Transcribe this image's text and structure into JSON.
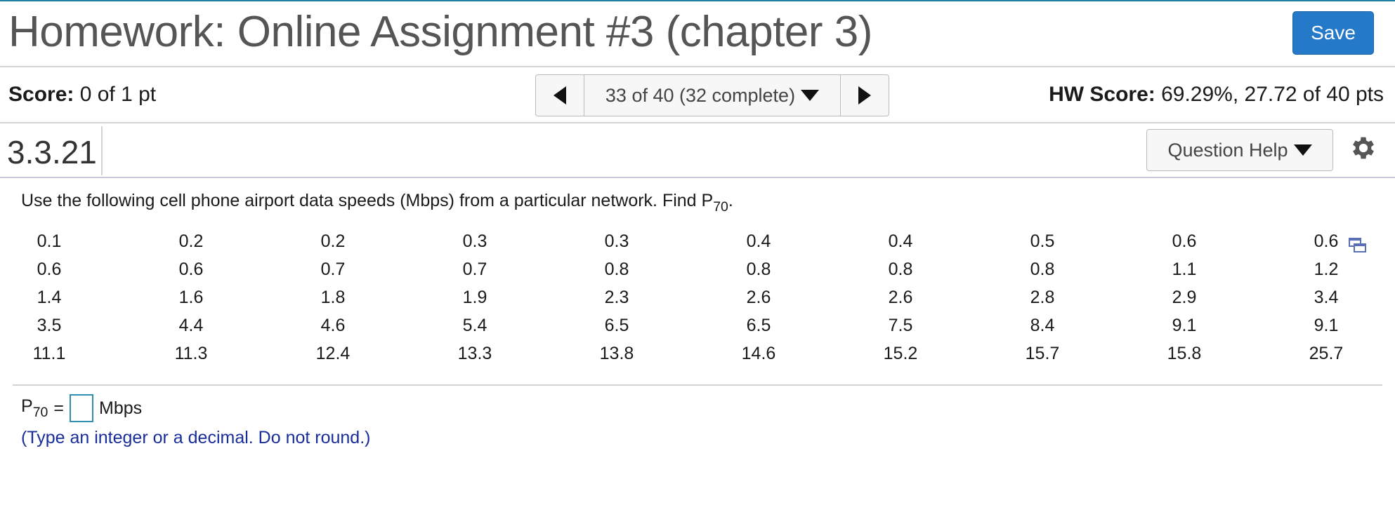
{
  "header": {
    "title": "Homework: Online Assignment #3 (chapter 3)",
    "save_label": "Save"
  },
  "score_bar": {
    "score_label": "Score:",
    "score_value": "0 of 1 pt",
    "nav_label": "33 of 40 (32 complete)",
    "hw_score_label": "HW Score:",
    "hw_score_value": "69.29%, 27.72 of 40 pts"
  },
  "question_bar": {
    "number": "3.3.21",
    "help_label": "Question Help"
  },
  "question": {
    "prompt_text": "Use the following cell phone airport data speeds (Mbps) from a particular network. Find P",
    "prompt_sub": "70",
    "prompt_end": ".",
    "data_rows": [
      [
        "0.1",
        "0.2",
        "0.2",
        "0.3",
        "0.3",
        "0.4",
        "0.4",
        "0.5",
        "0.6",
        "0.6"
      ],
      [
        "0.6",
        "0.6",
        "0.7",
        "0.7",
        "0.8",
        "0.8",
        "0.8",
        "0.8",
        "1.1",
        "1.2"
      ],
      [
        "1.4",
        "1.6",
        "1.8",
        "1.9",
        "2.3",
        "2.6",
        "2.6",
        "2.8",
        "2.9",
        "3.4"
      ],
      [
        "3.5",
        "4.4",
        "4.6",
        "5.4",
        "6.5",
        "6.5",
        "7.5",
        "8.4",
        "9.1",
        "9.1"
      ],
      [
        "11.1",
        "11.3",
        "12.4",
        "13.3",
        "13.8",
        "14.6",
        "15.2",
        "15.7",
        "15.8",
        "25.7"
      ]
    ],
    "answer_label": "P",
    "answer_sub": "70",
    "answer_equals": "=",
    "answer_value": "",
    "answer_unit": "Mbps",
    "hint": "(Type an integer or a decimal. Do not round.)"
  },
  "icons": {
    "prev": "left-triangle-icon",
    "next": "right-triangle-icon",
    "dropdown": "chevron-down-icon",
    "settings": "gear-icon",
    "copy": "copy-icon"
  },
  "colors": {
    "save_button": "#2479c9",
    "hint_text": "#1a2e9a",
    "answer_box_border": "#2f8fb0"
  }
}
